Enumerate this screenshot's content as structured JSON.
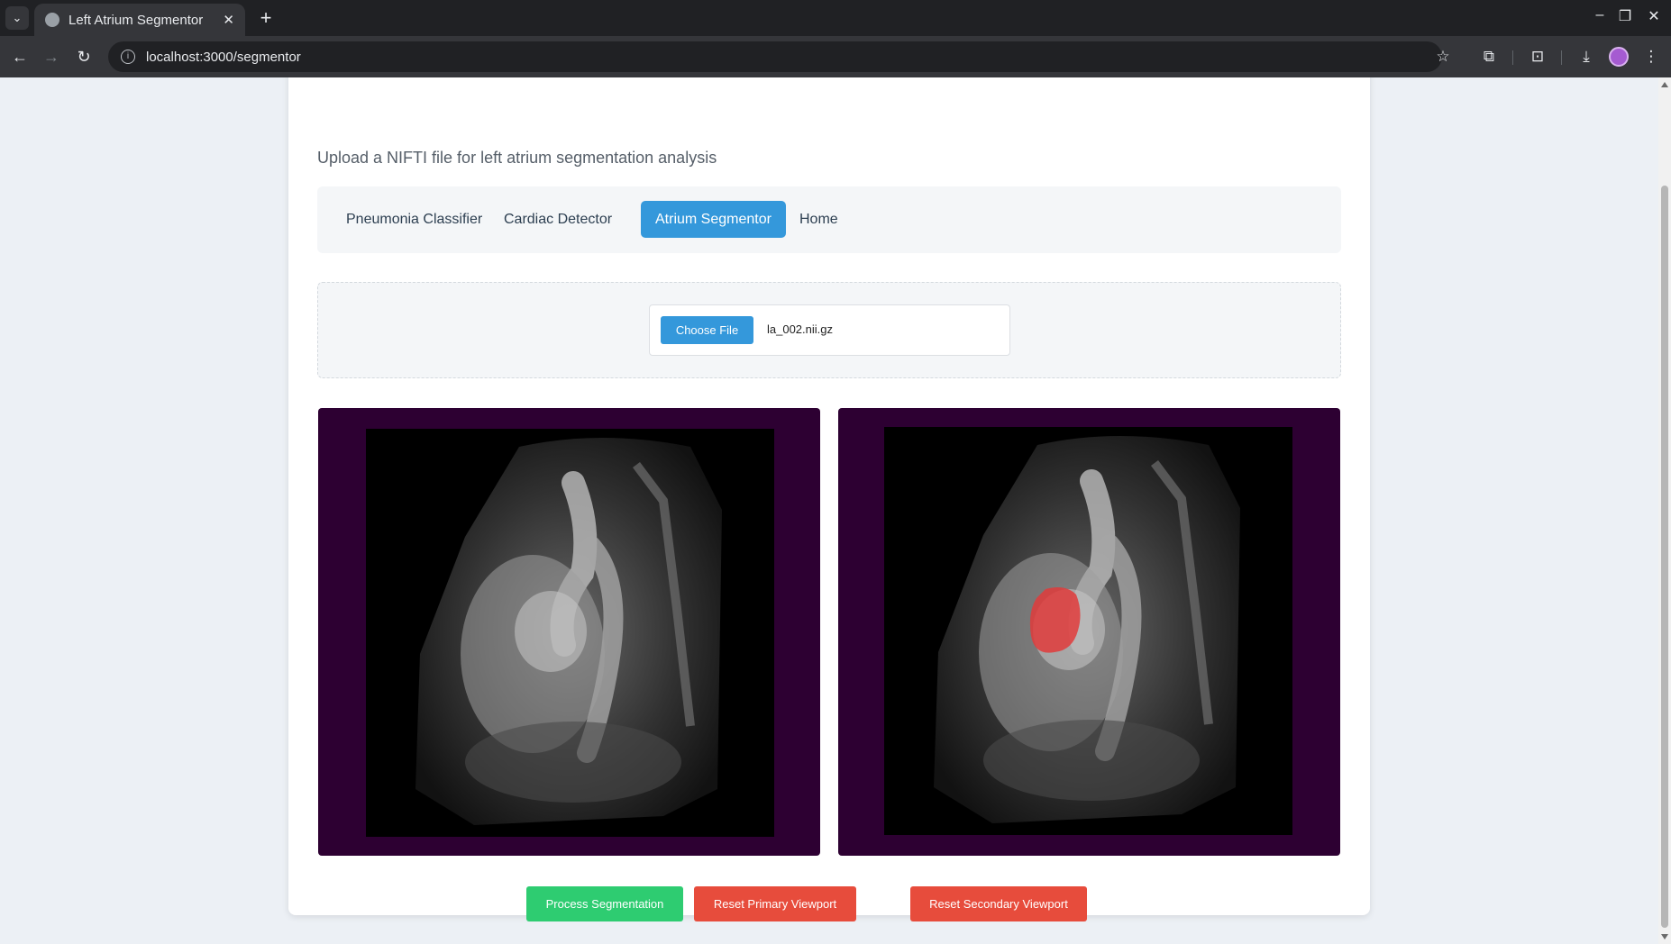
{
  "browser": {
    "tab_title": "Left Atrium Segmentor",
    "url": "localhost:3000/segmentor"
  },
  "page": {
    "subtitle": "Upload a NIFTI file for left atrium segmentation analysis",
    "nav": [
      {
        "label": "Pneumonia Classifier",
        "active": false
      },
      {
        "label": "Cardiac Detector",
        "active": false
      },
      {
        "label": "Atrium Segmentor",
        "active": true
      },
      {
        "label": "Home",
        "active": false
      }
    ],
    "upload": {
      "choose_label": "Choose File",
      "file_name": "la_002.nii.gz"
    },
    "actions": {
      "process_label": "Process Segmentation",
      "reset_primary_label": "Reset Primary Viewport",
      "reset_secondary_label": "Reset Secondary Viewport"
    }
  },
  "colors": {
    "accent": "#3498db",
    "success": "#2ecc71",
    "danger": "#e74c3c",
    "viewport_bg": "#2d0032",
    "mask": "#e03b3b"
  },
  "icons": {
    "tab_search": "chevron-down-icon",
    "favicon": "globe-icon",
    "close": "close-icon",
    "new_tab": "plus-icon",
    "back": "arrow-left-icon",
    "forward": "arrow-right-icon",
    "reload": "reload-icon",
    "site_info": "info-icon",
    "bookmark": "star-icon",
    "extensions": "puzzle-icon",
    "screenshot": "camera-icon",
    "download": "download-icon",
    "menu": "kebab-menu-icon"
  }
}
